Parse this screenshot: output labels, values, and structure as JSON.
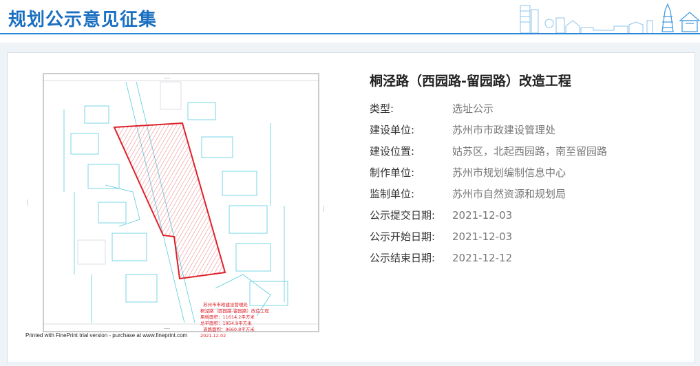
{
  "header": {
    "title": "规划公示意见征集"
  },
  "project": {
    "title": "桐泾路（西园路-留园路）改造工程",
    "fields": [
      {
        "label": "类型:",
        "value": "选址公示"
      },
      {
        "label": "建设单位:",
        "value": "苏州市市政建设管理处"
      },
      {
        "label": "建设位置:",
        "value": "姑苏区，北起西园路，南至留园路"
      },
      {
        "label": "制作单位:",
        "value": "苏州市规划编制信息中心"
      },
      {
        "label": "监制单位:",
        "value": "苏州市自然资源和规划局"
      },
      {
        "label": "公示提交日期:",
        "value": "2021-12-03"
      },
      {
        "label": "公示开始日期:",
        "value": "2021-12-03"
      },
      {
        "label": "公示结束日期:",
        "value": "2021-12-12"
      }
    ]
  },
  "plan_image": {
    "legend_lines": [
      "苏州市市政建设管理处",
      "桐泾路（西园路-留园路）改造工程",
      "用地面积：11614.2平方米",
      "总平面积：1954.9平方米",
      "道路面积：9660.8平方米",
      "2021.12.02"
    ],
    "print_note": "Printed with FinePrint trial version - purchase at www.fineprint.com"
  },
  "colors": {
    "brand_blue": "#1a6fc1",
    "boundary_red": "#e0202a",
    "cad_cyan": "#39c3d8"
  }
}
